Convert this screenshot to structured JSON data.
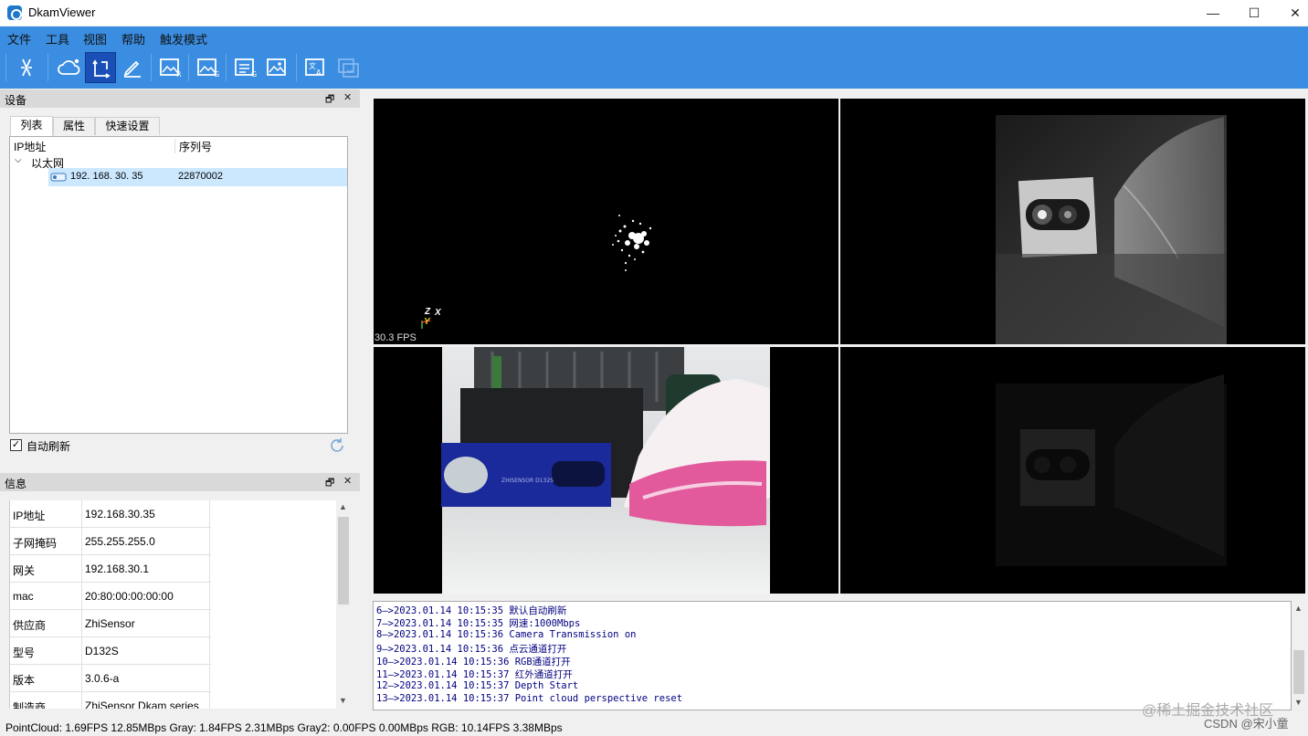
{
  "window": {
    "title": "DkamViewer",
    "controls": [
      "—",
      "☐",
      "✕"
    ]
  },
  "menu": [
    "文件",
    "工具",
    "视图",
    "帮助",
    "触发模式"
  ],
  "toolbar": {
    "buttons": [
      {
        "icon": "disconnect-icon"
      },
      {
        "icon": "cloud-point-icon"
      },
      {
        "icon": "axis-icon",
        "active": true
      },
      {
        "icon": "edit-icon"
      },
      {
        "icon": "image-r-icon"
      },
      {
        "icon": "image-g-icon"
      },
      {
        "icon": "list-icon"
      },
      {
        "icon": "image-icon"
      },
      {
        "icon": "text-image-icon"
      },
      {
        "icon": "record-icon",
        "disabled": true
      }
    ]
  },
  "device_panel": {
    "title": "设备",
    "tabs": [
      "列表",
      "属性",
      "快速设置"
    ],
    "columns": [
      "IP地址",
      "序列号"
    ],
    "group": "以太网",
    "device": {
      "ip": "192. 168. 30. 35",
      "serial": "22870002"
    },
    "auto_refresh": "自动刷新"
  },
  "info_panel": {
    "title": "信息",
    "rows": [
      {
        "k": "IP地址",
        "v": "192.168.30.35"
      },
      {
        "k": "子网掩码",
        "v": "255.255.255.0"
      },
      {
        "k": "网关",
        "v": "192.168.30.1"
      },
      {
        "k": "mac",
        "v": "20:80:00:00:00:00"
      },
      {
        "k": "供应商",
        "v": "ZhiSensor"
      },
      {
        "k": "型号",
        "v": "D132S"
      },
      {
        "k": "版本",
        "v": "3.0.6-a"
      },
      {
        "k": "制造商",
        "v": "ZhiSensor Dkam series"
      }
    ]
  },
  "viewer": {
    "fps": "30.3 FPS",
    "axis_z": "Z",
    "axis_x": "X",
    "axis_y": "Y",
    "logo_text": "ZHISENSOR D132S"
  },
  "log": [
    "6—>2023.01.14 10:15:35 默认自动刷新",
    "7—>2023.01.14 10:15:35 网速:1000Mbps",
    "8—>2023.01.14 10:15:36 Camera Transmission on",
    "9—>2023.01.14 10:15:36 点云通道打开",
    "10—>2023.01.14 10:15:36 RGB通道打开",
    "11—>2023.01.14 10:15:37 红外通道打开",
    "12—>2023.01.14 10:15:37 Depth Start",
    "13—>2023.01.14 10:15:37 Point cloud perspective reset"
  ],
  "status": "PointCloud: 1.69FPS 12.85MBps  Gray: 1.84FPS 2.31MBps  Gray2: 0.00FPS 0.00MBps  RGB: 10.14FPS 3.38MBps",
  "watermark": {
    "line1": "@稀土掘金技术社区",
    "line2": "CSDN @宋小童"
  }
}
